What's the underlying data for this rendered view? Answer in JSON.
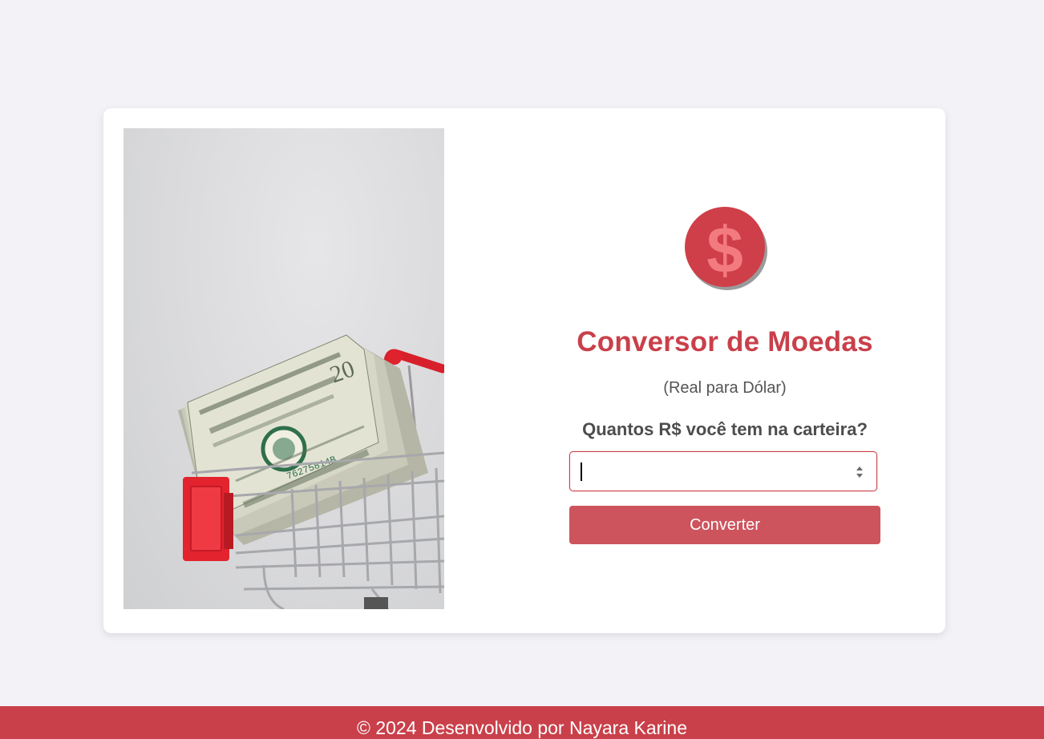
{
  "colors": {
    "background": "#f3f3f7",
    "card": "#ffffff",
    "accent": "#c9404a",
    "button": "#cd545d",
    "text_dark": "#4d4d4d"
  },
  "image": {
    "description_icon": "money-cart-photo-icon"
  },
  "logo": {
    "icon": "dollar-coin-icon",
    "symbol": "$"
  },
  "converter": {
    "title": "Conversor de Moedas",
    "subtitle": "(Real para Dólar)",
    "question": "Quantos R$ você tem na carteira?",
    "input_value": "",
    "button_label": "Converter"
  },
  "footer": {
    "text": "© 2024 Desenvolvido por Nayara Karine"
  }
}
